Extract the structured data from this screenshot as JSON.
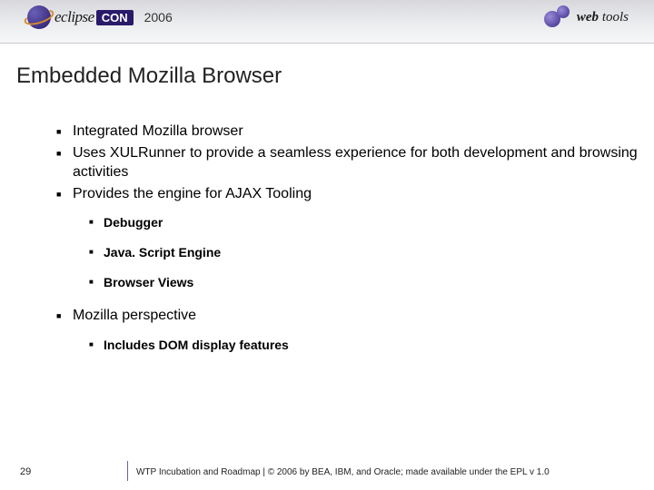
{
  "header": {
    "left_logo_text": "eclipse",
    "left_logo_badge": "CON",
    "left_logo_year": "2006",
    "right_logo_text_prefix": "web",
    "right_logo_text_suffix": " tools"
  },
  "title": "Embedded Mozilla Browser",
  "bullets": {
    "items": [
      "Integrated Mozilla browser",
      "Uses XULRunner to provide a seamless experience for both development and browsing activities",
      "Provides the engine for AJAX Tooling"
    ],
    "sub_after_third": [
      "Debugger",
      "Java. Script Engine",
      "Browser Views"
    ],
    "fourth": "Mozilla perspective",
    "sub_after_fourth": [
      "Includes DOM display features"
    ]
  },
  "footer": {
    "page_number": "29",
    "text": "WTP Incubation and Roadmap  |  © 2006 by BEA, IBM, and Oracle; made available under the EPL v 1.0"
  }
}
